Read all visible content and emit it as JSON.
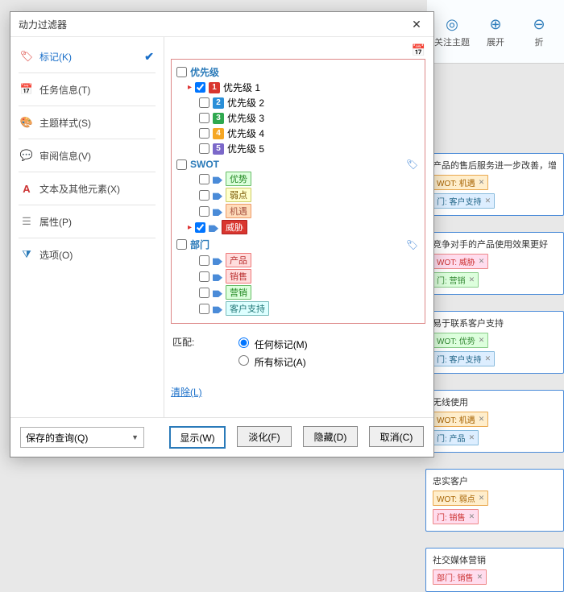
{
  "dialog": {
    "title": "动力过滤器"
  },
  "sidebar": {
    "items": [
      {
        "label": "标记(K)",
        "active": true
      },
      {
        "label": "任务信息(T)"
      },
      {
        "label": "主题样式(S)"
      },
      {
        "label": "审阅信息(V)"
      },
      {
        "label": "文本及其他元素(X)"
      },
      {
        "label": "属性(P)"
      },
      {
        "label": "选项(O)"
      }
    ]
  },
  "groups": {
    "priority": {
      "label": "优先级",
      "items": [
        "优先级 1",
        "优先级 2",
        "优先级 3",
        "优先级 4",
        "优先级 5"
      ]
    },
    "swot": {
      "label": "SWOT",
      "items": [
        "优势",
        "弱点",
        "机遇",
        "威胁"
      ]
    },
    "dept": {
      "label": "部门",
      "items": [
        "产品",
        "销售",
        "营销",
        "客户支持"
      ]
    }
  },
  "match": {
    "label": "匹配:",
    "any": "任何标记(M)",
    "all": "所有标记(A)"
  },
  "clear": "清除(L)",
  "footer": {
    "saved": "保存的查询(Q)",
    "show": "显示(W)",
    "fade": "淡化(F)",
    "hide": "隐藏(D)",
    "cancel": "取消(C)"
  },
  "ribbon": {
    "focus": "关注主题",
    "expand": "展开",
    "collapse": "折"
  },
  "cards": {
    "c1": {
      "title": "产品的售后服务进一步改善，增",
      "t1": "WOT: 机遇",
      "t2": "门: 客户支持"
    },
    "c2": {
      "title": "竞争对手的产品使用效果更好",
      "t1": "WOT: 威胁",
      "t2": "门: 营销"
    },
    "c3": {
      "title": "易于联系客户支持",
      "t1": "WOT: 优势",
      "t2": "门: 客户支持"
    },
    "c4": {
      "title": "无线使用",
      "t1": "WOT: 机遇",
      "t2": "门: 产品"
    },
    "c5": {
      "title": "忠实客户",
      "t1": "WOT: 弱点",
      "t2": "门: 销售"
    },
    "c6": {
      "title": "社交媒体营销",
      "t1": "部门: 销售"
    }
  }
}
